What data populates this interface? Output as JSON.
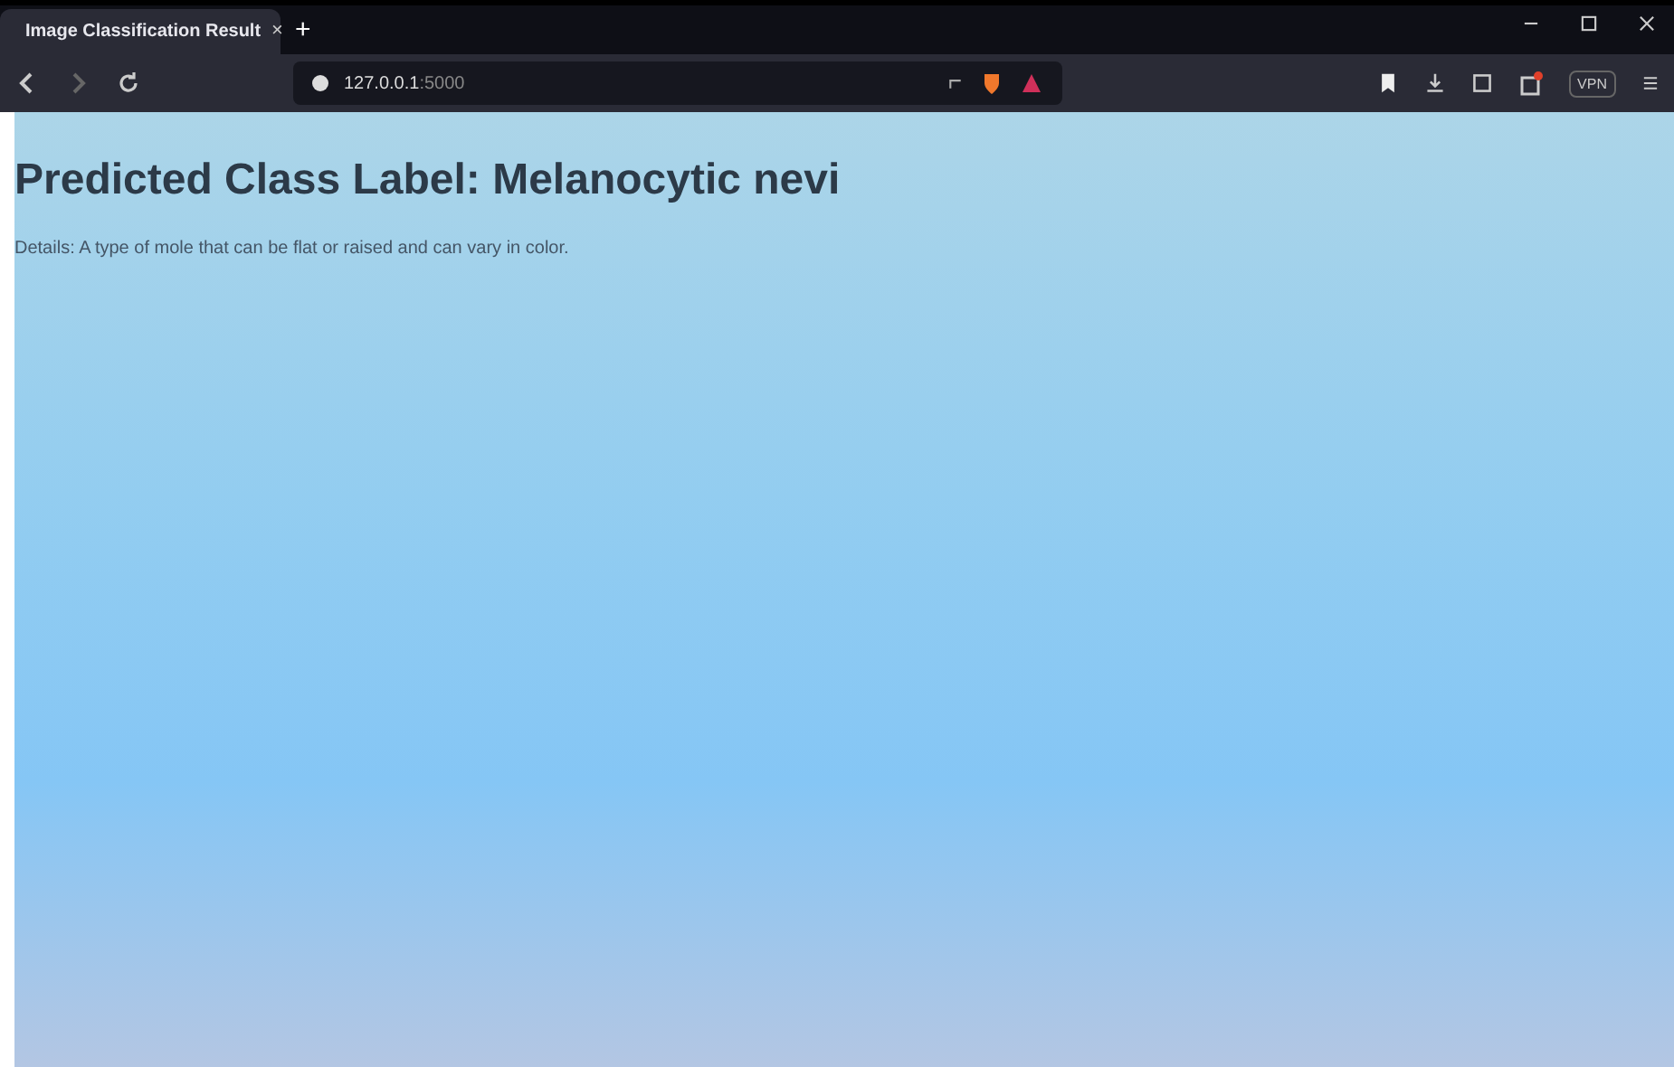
{
  "tab": {
    "title": "Image Classification Result",
    "close": "×",
    "new_tab": "+"
  },
  "address_bar": {
    "host": "127.0.0.1",
    "port": ":5000"
  },
  "toolbar": {
    "vpn": "VPN"
  },
  "page": {
    "heading": "Predicted Class Label: Melanocytic nevi",
    "details": "Details: A type of mole that can be flat or raised and can vary in color."
  }
}
